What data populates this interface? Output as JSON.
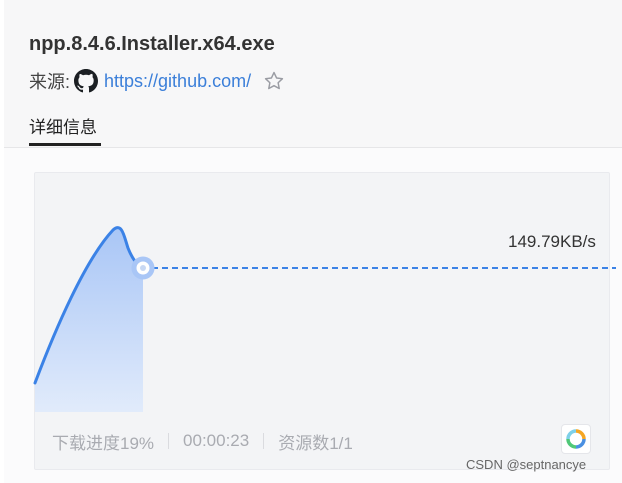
{
  "file": {
    "name": "npp.8.4.6.Installer.x64.exe"
  },
  "source": {
    "label": "来源:",
    "link": "https://github.com/",
    "icon": "github-icon"
  },
  "favorite": {
    "icon": "star-outline-icon"
  },
  "tabs": [
    {
      "label": "详细信息",
      "active": true
    }
  ],
  "download": {
    "speed": "149.79KB/s",
    "progress_text": "下载进度19%",
    "progress": 0.19,
    "elapsed": "00:00:23",
    "sources": "资源数1/1"
  },
  "colors": {
    "accent": "#3b82e6",
    "fill_top": "#a9c6f6",
    "fill_bottom": "#e1ebfb",
    "link": "#3b7fd9"
  },
  "watermark": "CSDN @septnancye"
}
